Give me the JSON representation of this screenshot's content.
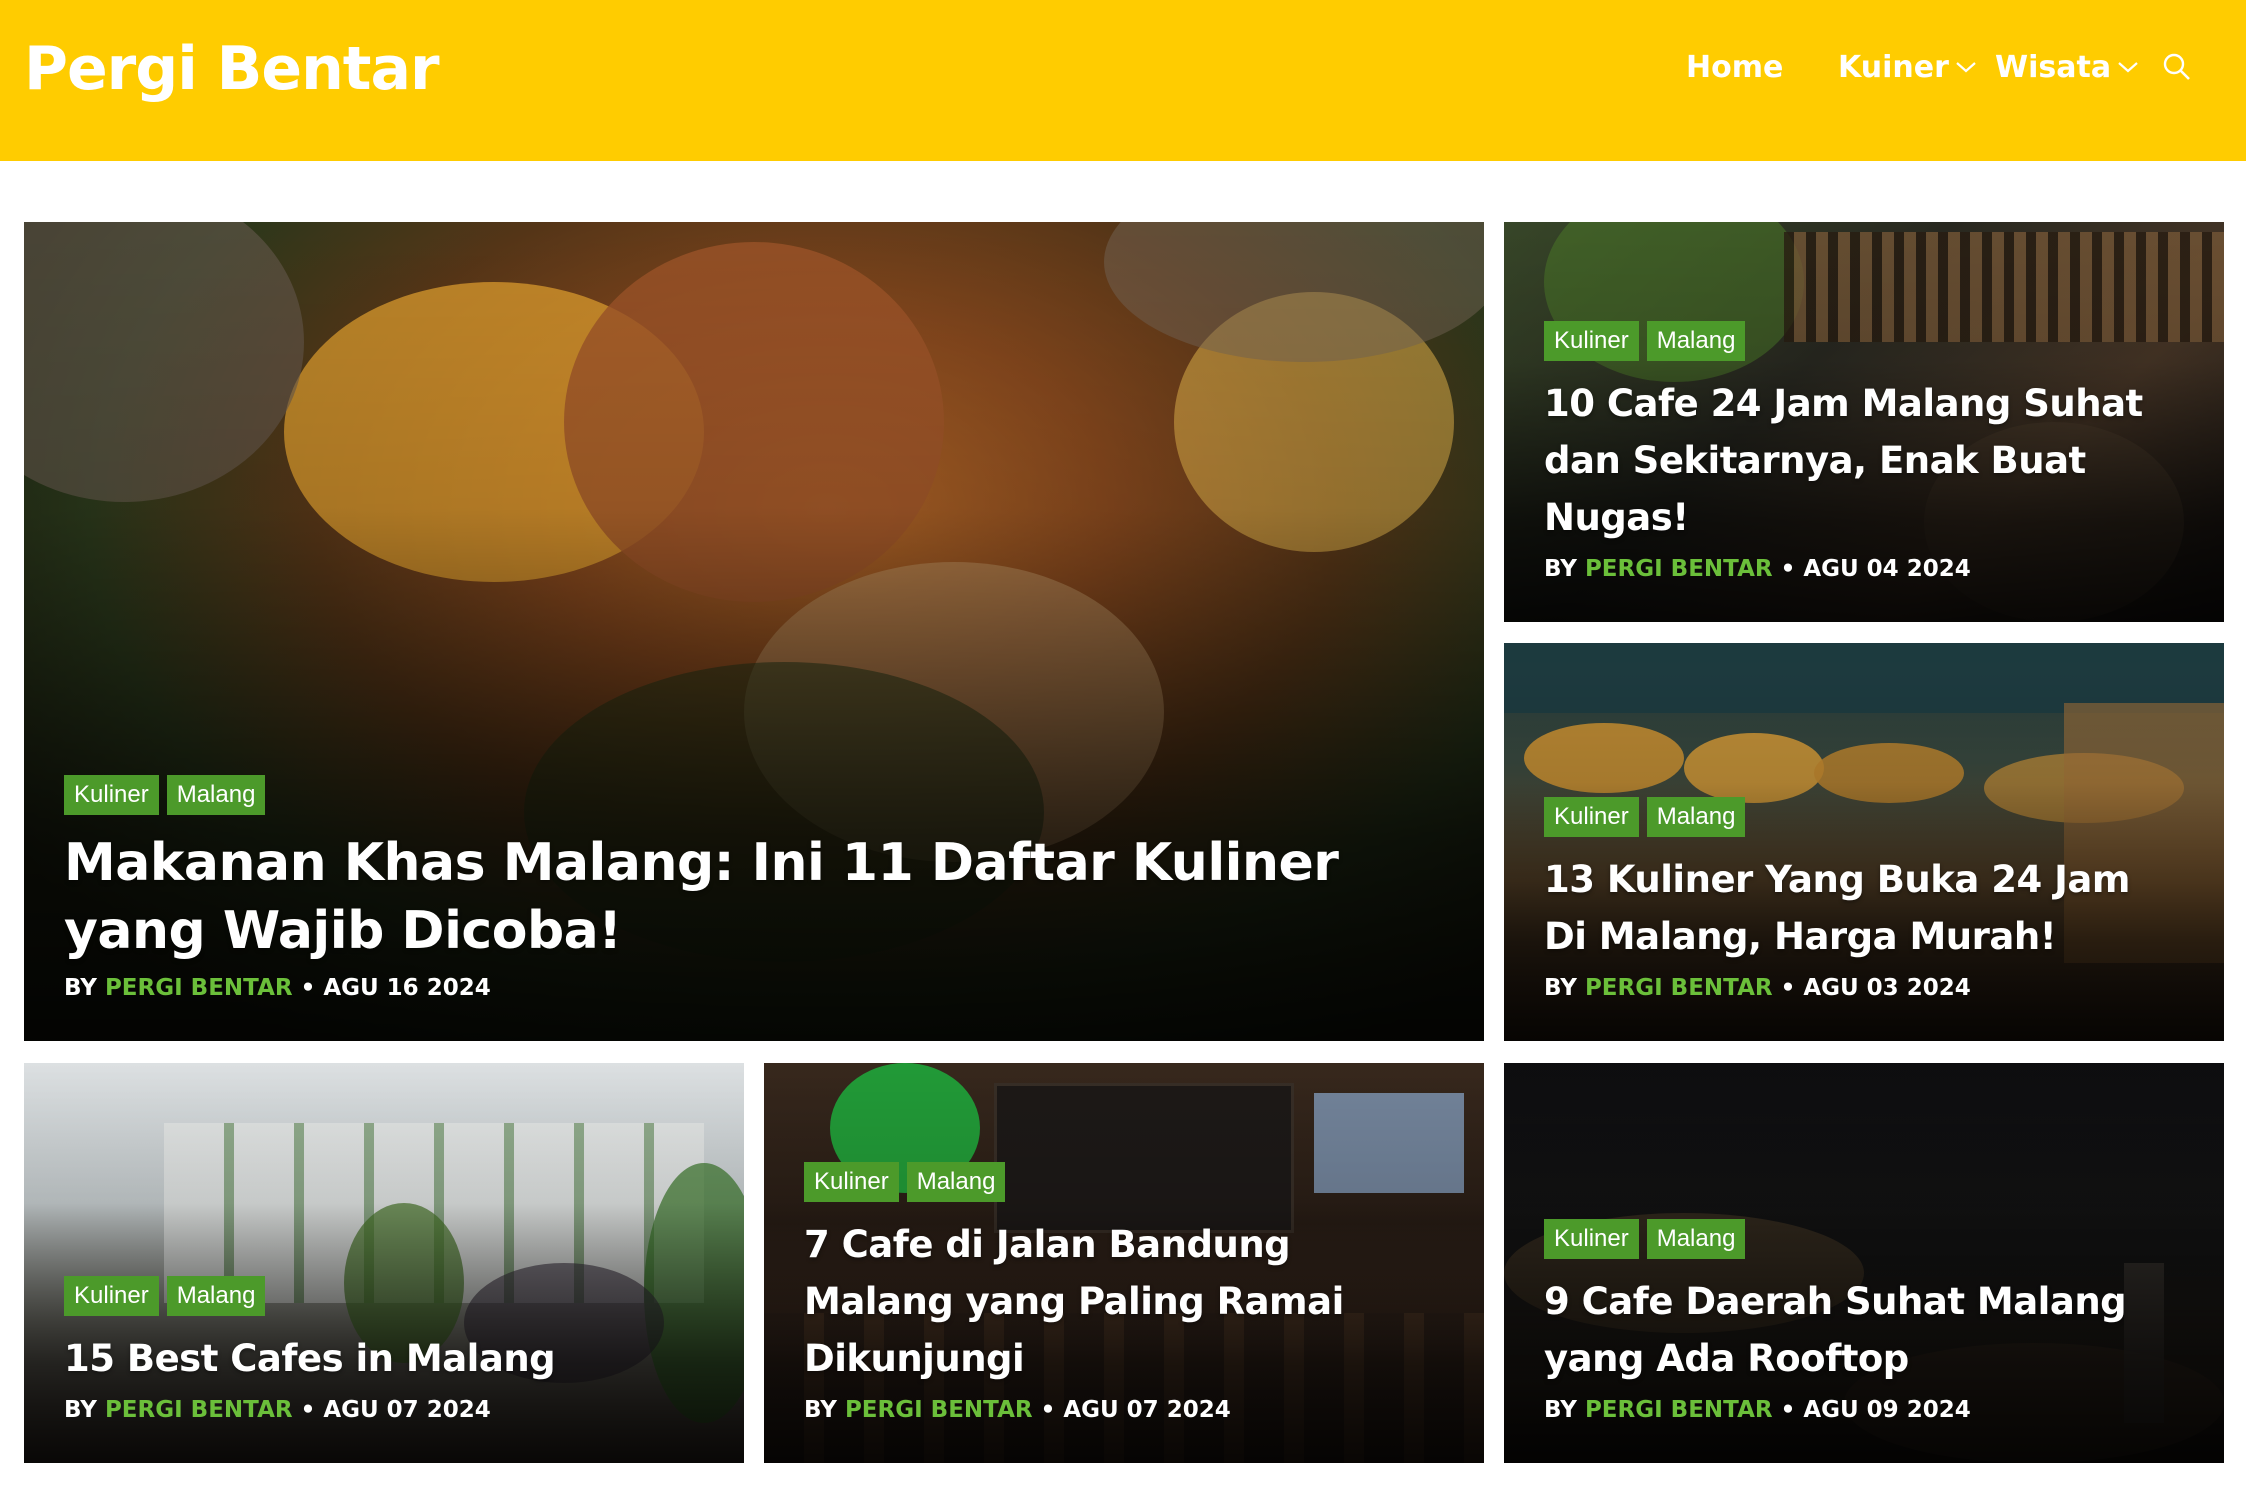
{
  "site": {
    "logo": "Pergi Bentar",
    "accent_color": "#ffcc00",
    "tag_color": "#4c9a2a",
    "author_color": "#6bbf3a"
  },
  "nav": {
    "home": "Home",
    "kuliner": "Kuiner",
    "wisata": "Wisata",
    "search_icon": "search-icon",
    "chevron_icon": "chevron-down-icon"
  },
  "posts": [
    {
      "tags": [
        "Kuliner",
        "Malang"
      ],
      "title": "Makanan Khas Malang: Ini 11 Daftar Kuliner yang Wajib Dicoba!",
      "by": "BY",
      "author": "PERGI BENTAR",
      "date": "• AGU 16 2024"
    },
    {
      "tags": [
        "Kuliner",
        "Malang"
      ],
      "title": "10 Cafe 24 Jam Malang Suhat dan Sekitarnya, Enak Buat Nugas!",
      "by": "BY",
      "author": "PERGI BENTAR",
      "date": "• AGU 04 2024"
    },
    {
      "tags": [
        "Kuliner",
        "Malang"
      ],
      "title": "13 Kuliner Yang Buka 24 Jam Di Malang, Harga Murah!",
      "by": "BY",
      "author": "PERGI BENTAR",
      "date": "• AGU 03 2024"
    },
    {
      "tags": [
        "Kuliner",
        "Malang"
      ],
      "title": "15 Best Cafes in Malang",
      "by": "BY",
      "author": "PERGI BENTAR",
      "date": "• AGU 07 2024"
    },
    {
      "tags": [
        "Kuliner",
        "Malang"
      ],
      "title": "7 Cafe di Jalan Bandung Malang yang Paling Ramai Dikunjungi",
      "by": "BY",
      "author": "PERGI BENTAR",
      "date": "• AGU 07 2024"
    },
    {
      "tags": [
        "Kuliner",
        "Malang"
      ],
      "title": "9 Cafe Daerah Suhat Malang yang Ada Rooftop",
      "by": "BY",
      "author": "PERGI BENTAR",
      "date": "• AGU 09 2024"
    }
  ]
}
